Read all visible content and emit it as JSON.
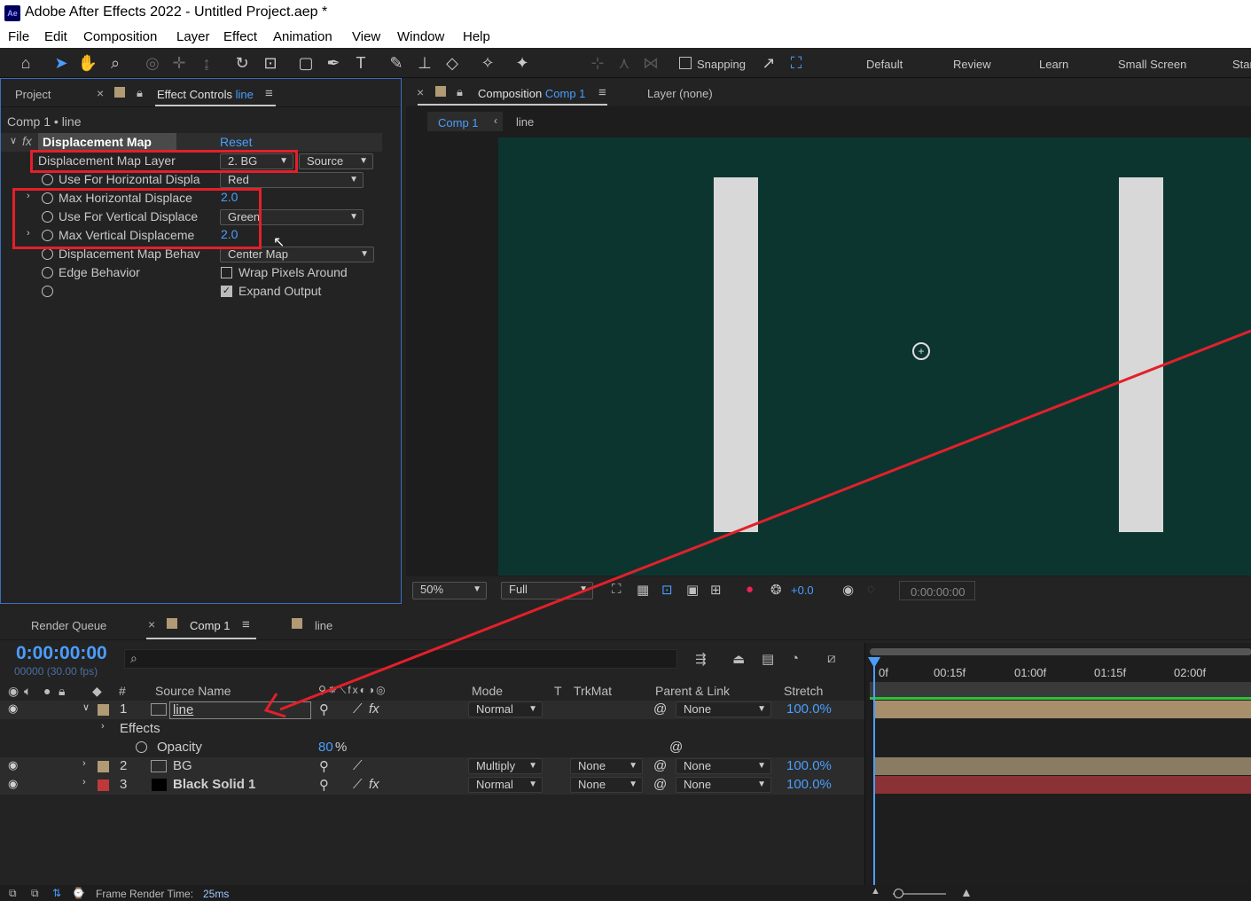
{
  "window": {
    "app_badge": "Ae",
    "title": "Adobe After Effects 2022 - Untitled Project.aep *"
  },
  "menu": [
    "File",
    "Edit",
    "Composition",
    "Layer",
    "Effect",
    "Animation",
    "View",
    "Window",
    "Help"
  ],
  "toolbar": {
    "snapping_label": "Snapping",
    "workspaces": [
      "Default",
      "Review",
      "Learn",
      "Small Screen",
      "Star"
    ]
  },
  "left_panel": {
    "tab_project": "Project",
    "tab_effect_controls": "Effect Controls",
    "tab_effect_layer": "line",
    "breadcrumb": "Comp 1 • line",
    "effect_name": "Displacement Map",
    "reset": "Reset",
    "props": [
      {
        "label": "Displacement Map Layer",
        "value": "2. BG",
        "value2": "Source"
      },
      {
        "label": "Use For Horizontal Displa",
        "value": "Red"
      },
      {
        "label": "Max Horizontal Displace",
        "value": "2.0"
      },
      {
        "label": "Use For Vertical Displace",
        "value": "Green"
      },
      {
        "label": "Max Vertical Displaceme",
        "value": "2.0"
      },
      {
        "label": "Displacement Map Behav",
        "value": "Center Map"
      },
      {
        "label": "Edge Behavior",
        "value": "Wrap Pixels Around"
      },
      {
        "label": "",
        "value": "Expand Output"
      }
    ]
  },
  "comp_panel": {
    "tab_label": "Composition",
    "tab_comp": "Comp 1",
    "layer_tab": "Layer (none)",
    "sub_tab_active": "Comp 1",
    "sub_tab_2": "line",
    "zoom": "50%",
    "resolution": "Full",
    "exposure": "+0.0",
    "timecode": "0:00:00:00"
  },
  "timeline": {
    "tab_render": "Render Queue",
    "tab_comp": "Comp 1",
    "tab_line": "line",
    "timecode": "0:00:00:00",
    "fps": "00000 (30.00 fps)",
    "search_placeholder": "",
    "cols": {
      "num": "#",
      "source": "Source Name",
      "mode": "Mode",
      "t": "T",
      "trkmat": "TrkMat",
      "parent": "Parent & Link",
      "stretch": "Stretch"
    },
    "ruler": [
      "0f",
      "00:15f",
      "01:00f",
      "01:15f",
      "02:00f"
    ],
    "layers": [
      {
        "num": "1",
        "name": "line",
        "mode": "Normal",
        "trkmat": "",
        "parent": "None",
        "stretch": "100.0%"
      },
      {
        "num": "2",
        "name": "BG",
        "mode": "Multiply",
        "trkmat": "None",
        "parent": "None",
        "stretch": "100.0%"
      },
      {
        "num": "3",
        "name": "Black Solid 1",
        "mode": "Normal",
        "trkmat": "None",
        "parent": "None",
        "stretch": "100.0%"
      }
    ],
    "effects_label": "Effects",
    "opacity_label": "Opacity",
    "opacity_value": "80",
    "opacity_unit": "%"
  },
  "status": {
    "label": "Frame Render Time:",
    "value": "25ms"
  },
  "colors": {
    "accent": "#4a9eff",
    "annotation_red": "#e3202a",
    "label_tan": "#b19a74",
    "label_red": "#c0393a"
  }
}
